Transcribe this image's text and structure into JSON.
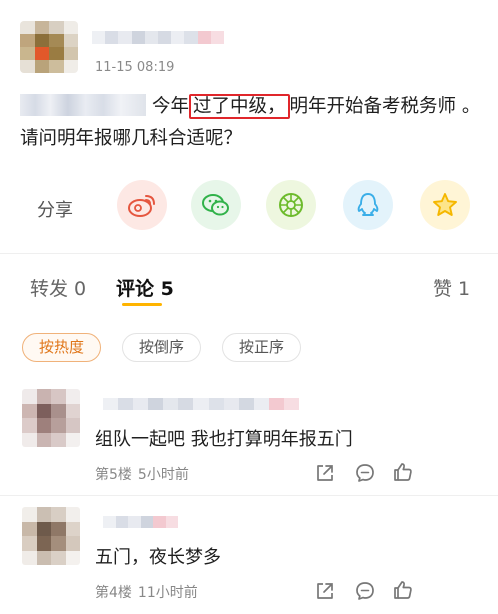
{
  "post": {
    "time": "11-15 08:19",
    "text_before": "今年",
    "highlight": "过了中级，",
    "text_after": "明年开始备考税务师 。请问明年报哪几科合适呢？"
  },
  "share": {
    "label": "分享",
    "targets": [
      {
        "name": "weibo",
        "bg": "#fde8e4",
        "color": "#e5563f"
      },
      {
        "name": "wechat",
        "bg": "#e7f6e9",
        "color": "#31b24a"
      },
      {
        "name": "moments",
        "bg": "#eef7df",
        "color": "#6dbb2c"
      },
      {
        "name": "qq",
        "bg": "#e3f3fb",
        "color": "#3aaee8"
      },
      {
        "name": "favorite",
        "bg": "#fff5d6",
        "color": "#f5b700"
      }
    ]
  },
  "tabs": {
    "repost": "转发 0",
    "comments": "评论 5",
    "likes": "赞 1"
  },
  "sort": {
    "hot": "按热度",
    "reverse": "按倒序",
    "forward": "按正序"
  },
  "comments": [
    {
      "text": "组队一起吧 我也打算明年报五门",
      "floor": "第5楼",
      "time": "5小时前"
    },
    {
      "text": "五门，夜长梦多",
      "floor": "第4楼",
      "time": "11小时前"
    }
  ],
  "colors": {
    "accent": "#ffb400",
    "highlight_border": "#e0262b",
    "active_sort": "#e0771b"
  }
}
